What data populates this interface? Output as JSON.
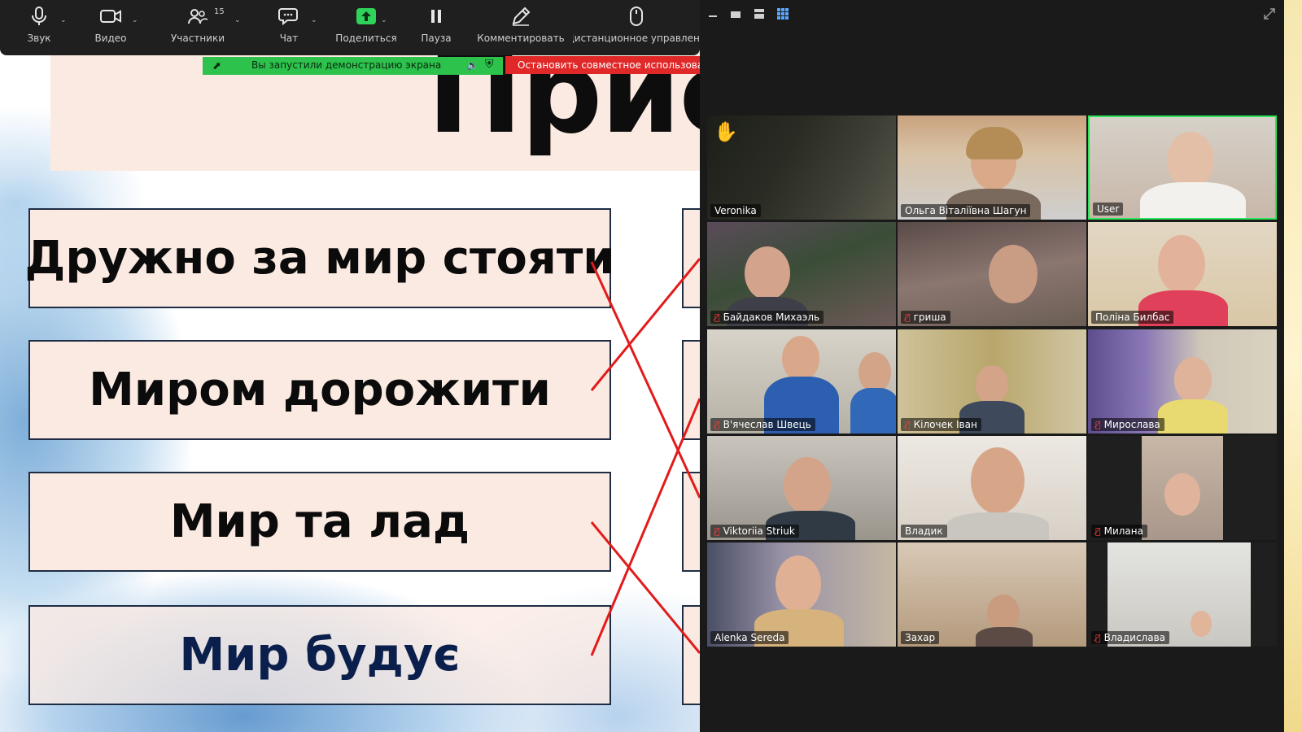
{
  "toolbar": {
    "audio": "Звук",
    "video": "Видео",
    "participants": "Участники",
    "participants_count": "15",
    "chat": "Чат",
    "share": "Поделиться",
    "pause": "Пауза",
    "annotate": "Комментировать",
    "remote": "Дистанционное управлени"
  },
  "share_status": {
    "message": "Вы запустили демонстрацию экрана",
    "stop": "Остановить совместное использова"
  },
  "slide": {
    "title": "Прис",
    "phrases": [
      "Дружно за мир стояти",
      "Миром дорожити",
      "Мир та лад",
      "Мир будує"
    ]
  },
  "gallery": {
    "raised_hand": "✋",
    "tiles": [
      {
        "name": "Veronika",
        "muted": false,
        "active": false
      },
      {
        "name": "Ольга Віталіївна Шагун",
        "muted": false,
        "active": false
      },
      {
        "name": "User",
        "muted": false,
        "active": true
      },
      {
        "name": "Байдаков Михаэль",
        "muted": true,
        "active": false
      },
      {
        "name": "гриша",
        "muted": true,
        "active": false
      },
      {
        "name": "Поліна Билбас",
        "muted": false,
        "active": false
      },
      {
        "name": "В'ячеслав Швець",
        "muted": true,
        "active": false
      },
      {
        "name": "Кілочек Іван",
        "muted": true,
        "active": false
      },
      {
        "name": "Мирослава",
        "muted": true,
        "active": false
      },
      {
        "name": "Viktoriia Striuk",
        "muted": true,
        "active": false
      },
      {
        "name": "Владик",
        "muted": false,
        "active": false
      },
      {
        "name": "Милана",
        "muted": true,
        "active": false
      },
      {
        "name": "Alenka Sereda",
        "muted": false,
        "active": false
      },
      {
        "name": "Захар",
        "muted": false,
        "active": false
      },
      {
        "name": "Владислава",
        "muted": true,
        "active": false
      }
    ]
  }
}
